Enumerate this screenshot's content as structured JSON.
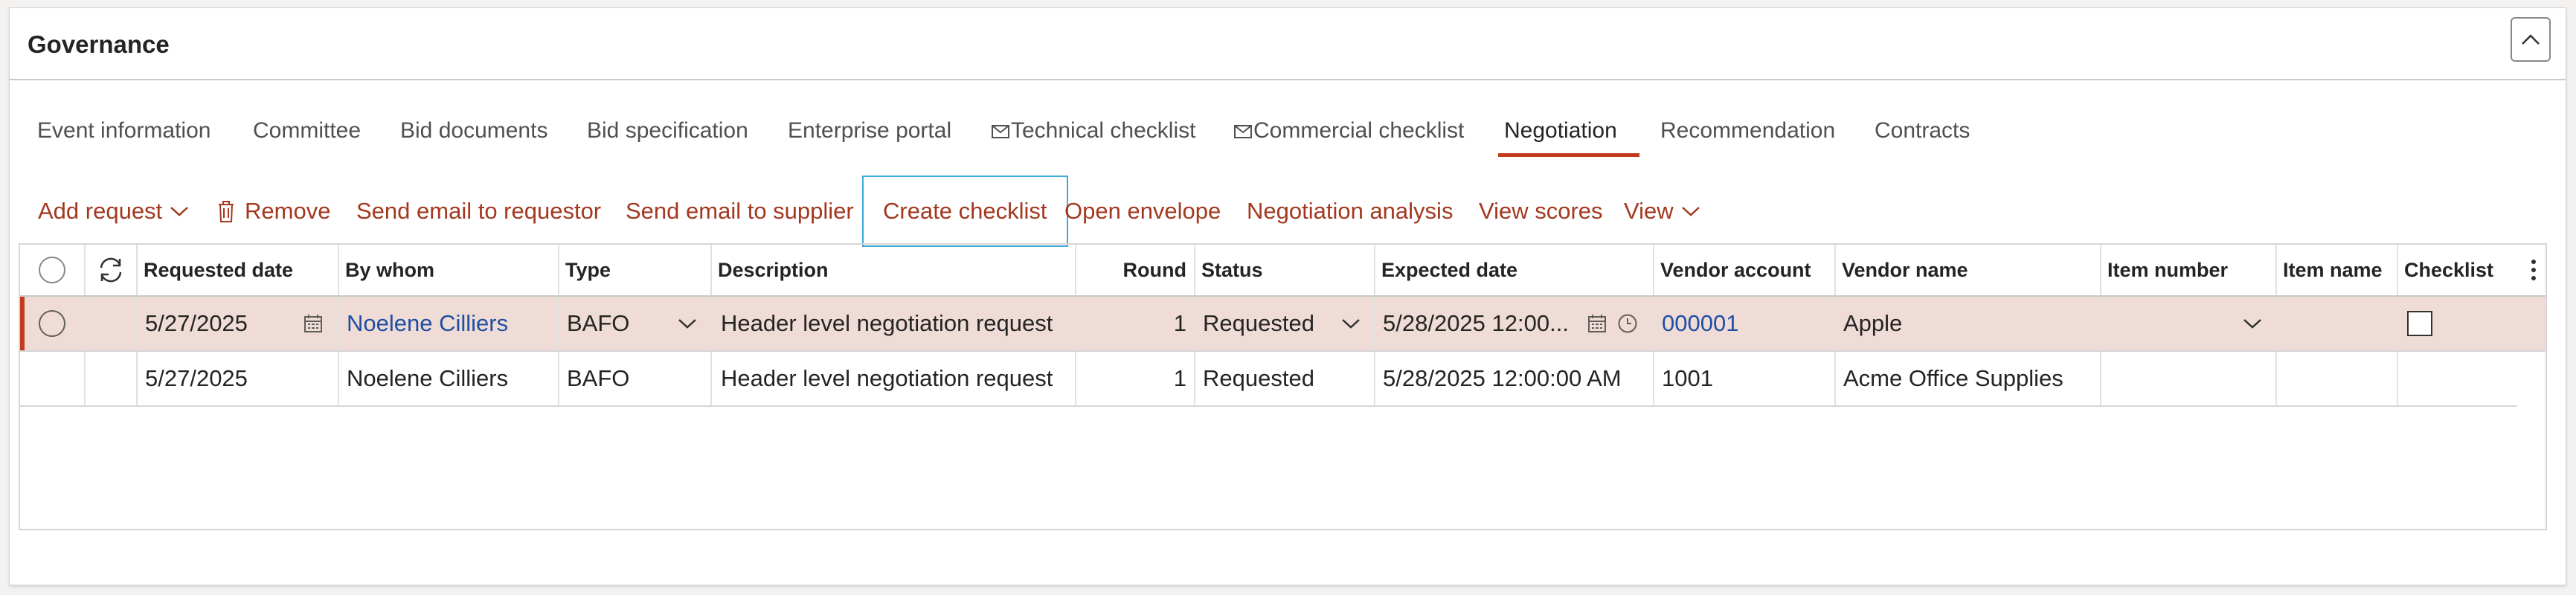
{
  "panel": {
    "title": "Governance"
  },
  "tabs": [
    {
      "label": "Event information",
      "icon": null
    },
    {
      "label": "Committee",
      "icon": null
    },
    {
      "label": "Bid documents",
      "icon": null
    },
    {
      "label": "Bid specification",
      "icon": null
    },
    {
      "label": "Enterprise portal",
      "icon": null
    },
    {
      "label": "Technical checklist",
      "icon": "envelope-icon"
    },
    {
      "label": "Commercial checklist",
      "icon": "envelope-icon"
    },
    {
      "label": "Negotiation",
      "icon": null,
      "active": true
    },
    {
      "label": "Recommendation",
      "icon": null
    },
    {
      "label": "Contracts",
      "icon": null
    }
  ],
  "toolbar": {
    "add_request": "Add request",
    "remove": "Remove",
    "send_email_requestor": "Send email to requestor",
    "send_email_supplier": "Send email to supplier",
    "create_checklist": "Create checklist",
    "open_envelope": "Open envelope",
    "negotiation_analysis": "Negotiation analysis",
    "view_scores": "View scores",
    "view": "View"
  },
  "grid": {
    "columns": [
      "Requested date",
      "By whom",
      "Type",
      "Description",
      "Round",
      "Status",
      "Expected date",
      "Vendor account",
      "Vendor name",
      "Item number",
      "Item name",
      "Checklist"
    ],
    "rows": [
      {
        "requested_date": "5/27/2025",
        "by_whom": "Noelene Cilliers",
        "type": "BAFO",
        "description": "Header level negotiation request",
        "round": "1",
        "status": "Requested",
        "expected_date": "5/28/2025 12:00...",
        "vendor_account": "000001",
        "vendor_name": "Apple",
        "item_number": "",
        "item_name": "",
        "checklist": false
      },
      {
        "requested_date": "5/27/2025",
        "by_whom": "Noelene Cilliers",
        "type": "BAFO",
        "description": "Header level negotiation request",
        "round": "1",
        "status": "Requested",
        "expected_date": "5/28/2025 12:00:00 AM",
        "vendor_account": "1001",
        "vendor_name": "Acme Office Supplies",
        "item_number": "",
        "item_name": ""
      }
    ]
  },
  "colors": {
    "accent": "#a3381f",
    "active_tab": "#c33a1f",
    "selected_row": "#efdcd6",
    "link": "#1f4fa3",
    "focus": "#3ea8d9"
  }
}
